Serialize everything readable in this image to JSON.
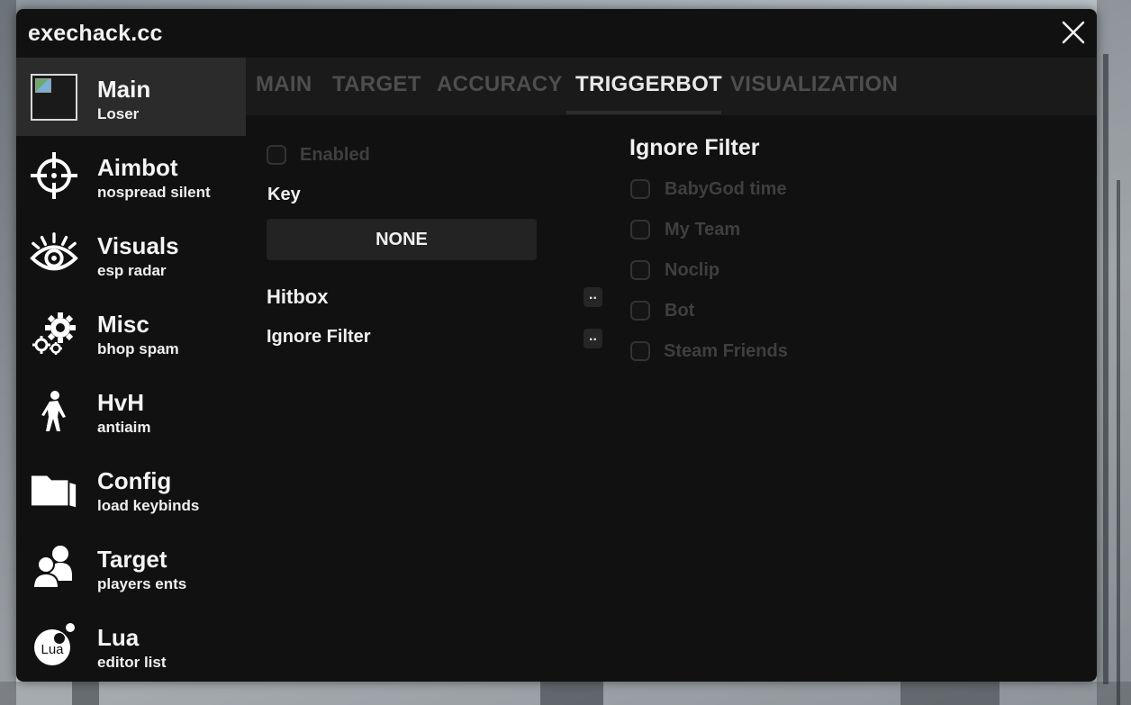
{
  "app": {
    "title": "exechack.cc"
  },
  "sidebar": {
    "items": [
      {
        "label": "Main",
        "sub": "Loser",
        "icon": "avatar-icon",
        "active": true
      },
      {
        "label": "Aimbot",
        "sub": "nospread silent",
        "icon": "crosshair-icon"
      },
      {
        "label": "Visuals",
        "sub": "esp radar",
        "icon": "eye-icon"
      },
      {
        "label": "Misc",
        "sub": "bhop spam",
        "icon": "gears-icon"
      },
      {
        "label": "HvH",
        "sub": "antiaim",
        "icon": "soldier-icon"
      },
      {
        "label": "Config",
        "sub": "load keybinds",
        "icon": "folder-icon"
      },
      {
        "label": "Target",
        "sub": "players ents",
        "icon": "users-icon"
      },
      {
        "label": "Lua",
        "sub": "editor list",
        "icon": "lua-icon"
      }
    ]
  },
  "tabs": [
    {
      "label": "MAIN"
    },
    {
      "label": "TARGET"
    },
    {
      "label": "ACCURACY"
    },
    {
      "label": "TRIGGERBOT",
      "active": true
    },
    {
      "label": "VISUALIZATION"
    }
  ],
  "triggerbot": {
    "enabled_label": "Enabled",
    "enabled": false,
    "key_label": "Key",
    "key_value": "NONE",
    "hitbox_label": "Hitbox",
    "hitbox_more": "..",
    "ignore_filter_label": "Ignore Filter",
    "ignore_filter_more": ".."
  },
  "ignore_filter": {
    "title": "Ignore Filter",
    "options": [
      {
        "label": "BabyGod time",
        "checked": false
      },
      {
        "label": "My Team",
        "checked": false
      },
      {
        "label": "Noclip",
        "checked": false
      },
      {
        "label": "Bot",
        "checked": false
      },
      {
        "label": "Steam Friends",
        "checked": false
      }
    ]
  },
  "colors": {
    "window_bg": "#111111",
    "sidebar_active": "#2b2b2b",
    "tab_active": "#e8e8e8",
    "tab_inactive": "#4e4e4e",
    "disabled_text": "#3f3f3f"
  }
}
